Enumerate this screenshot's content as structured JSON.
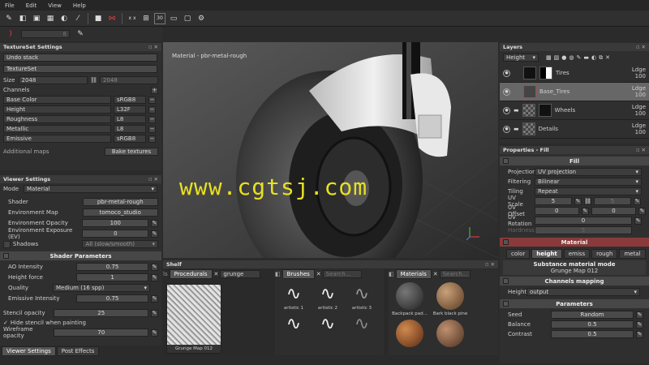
{
  "menu": [
    "File",
    "Edit",
    "View",
    "Help"
  ],
  "toolbar": {
    "uv_label": "x x",
    "num_label": "30"
  },
  "toolbar2": {
    "value": "8"
  },
  "textureset": {
    "title": "TextureSet Settings",
    "undo": "Undo stack",
    "textureset_btn": "TextureSet",
    "size_label": "Size",
    "size_a": "2048",
    "size_b": "2048",
    "channels_label": "Channels",
    "channels": [
      {
        "name": "Base Color",
        "fmt": "sRGB8"
      },
      {
        "name": "Height",
        "fmt": "L32F"
      },
      {
        "name": "Roughness",
        "fmt": "L8"
      },
      {
        "name": "Metallic",
        "fmt": "L8"
      },
      {
        "name": "Emissive",
        "fmt": "sRGB8"
      }
    ],
    "additional": "Additional maps",
    "bake": "Bake textures"
  },
  "viewer": {
    "title": "Viewer Settings",
    "mode_label": "Mode",
    "mode": "Material",
    "rows": [
      {
        "label": "Shader",
        "value": "pbr-metal-rough"
      },
      {
        "label": "Environment Map",
        "value": "tomoco_studio"
      },
      {
        "label": "Environment Opacity",
        "value": "100"
      },
      {
        "label": "Environment Exposure (EV)",
        "value": "0"
      }
    ],
    "shadows_label": "Shadows",
    "shadows": "All (slow/smooth)",
    "shader_params": "Shader Parameters",
    "params": [
      {
        "label": "AO Intensity",
        "value": "0.75"
      },
      {
        "label": "Height force",
        "value": "1"
      },
      {
        "label": "Quality",
        "value": "Medium (16 spp)"
      },
      {
        "label": "Emissive Intensity",
        "value": "0.75"
      }
    ],
    "stencil_label": "Stencil opacity",
    "stencil": "25",
    "hide_stencil": "Hide stencil when painting",
    "wire_label": "Wireframe opacity",
    "wire": "70",
    "tabs": [
      "Viewer Settings",
      "Post Effects"
    ]
  },
  "viewport": {
    "label": "Material - pbr-metal-rough",
    "watermark": "www.cgtsj.com"
  },
  "shelf": {
    "title": "Shelf",
    "proc_tab": "Procedurals",
    "proc_search": "grunge",
    "proc_item": "Grunge Map 012",
    "brushes_tab": "Brushes",
    "search": "Search...",
    "brushes": [
      "artistic 1",
      "artistic 2",
      "artistic 3"
    ],
    "materials_tab": "Materials",
    "materials": [
      "Backpack pad...",
      "Bark black pine"
    ]
  },
  "layers": {
    "title": "Layers",
    "mode": "Height",
    "items": [
      {
        "name": "Tires",
        "blend": "Ldge",
        "opacity": "100"
      },
      {
        "name": "Base_Tires",
        "blend": "Ldge",
        "opacity": "100"
      },
      {
        "name": "Wheels",
        "blend": "Ldge",
        "opacity": "100"
      },
      {
        "name": "Details",
        "blend": "Ldge",
        "opacity": "100"
      }
    ]
  },
  "props": {
    "title": "Properties - Fill",
    "fill": "Fill",
    "projection_label": "Projection",
    "projection": "UV projection",
    "filtering_label": "Filtering",
    "filtering": "Bilinear",
    "tiling_label": "Tiling",
    "tiling": "Repeat",
    "uvscale_label": "UV Scale",
    "uvscale": "5",
    "uvscale2": "5",
    "uvoffset_label": "UV Offset",
    "uvoffset": "0",
    "uvoffset2": "0",
    "uvrot_label": "UV Rotation",
    "uvrot": "0",
    "hardness_label": "Hardness",
    "hardness": "5",
    "material": "Material",
    "mat_tabs": [
      "color",
      "height",
      "emiss",
      "rough",
      "metal"
    ],
    "substance_title": "Substance material mode",
    "substance_name": "Grunge Map 012",
    "channels_mapping": "Channels mapping",
    "height_label": "Height",
    "height_val": "output",
    "parameters": "Parameters",
    "p_rows": [
      {
        "label": "Seed",
        "value": "Random"
      },
      {
        "label": "Balance",
        "value": "0.5"
      },
      {
        "label": "Contrast",
        "value": "0.5"
      }
    ]
  }
}
